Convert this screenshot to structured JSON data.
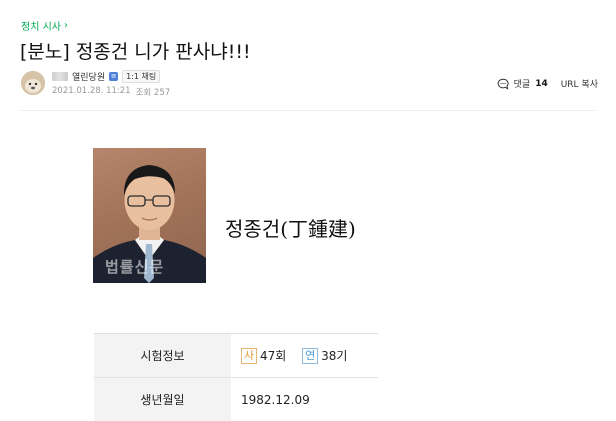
{
  "breadcrumb": {
    "label": "정치 시사"
  },
  "post": {
    "title": "[분노] 정종건 니가 판사냐!!!"
  },
  "author": {
    "grade": "열린당원",
    "chat_label": "1:1 채팅",
    "date": "2021.01.28. 11:21",
    "views_label": "조회 257"
  },
  "tools": {
    "comment_label": "댓글",
    "comment_count": "14",
    "url_copy": "URL 복사"
  },
  "profile": {
    "name": "정종건(丁鍾建)",
    "watermark": "법률신문",
    "rows": [
      {
        "label": "시험정보",
        "items": [
          {
            "badge": "사",
            "value": "47회"
          },
          {
            "badge": "연",
            "value": "38기"
          }
        ]
      },
      {
        "label": "생년월일",
        "value": "1982.12.09"
      }
    ]
  },
  "colors": {
    "accent": "#03a94f",
    "grade_blue": "#4a7ed8",
    "badge_orange": "#e39b3a",
    "badge_blue": "#4a9ad6"
  }
}
